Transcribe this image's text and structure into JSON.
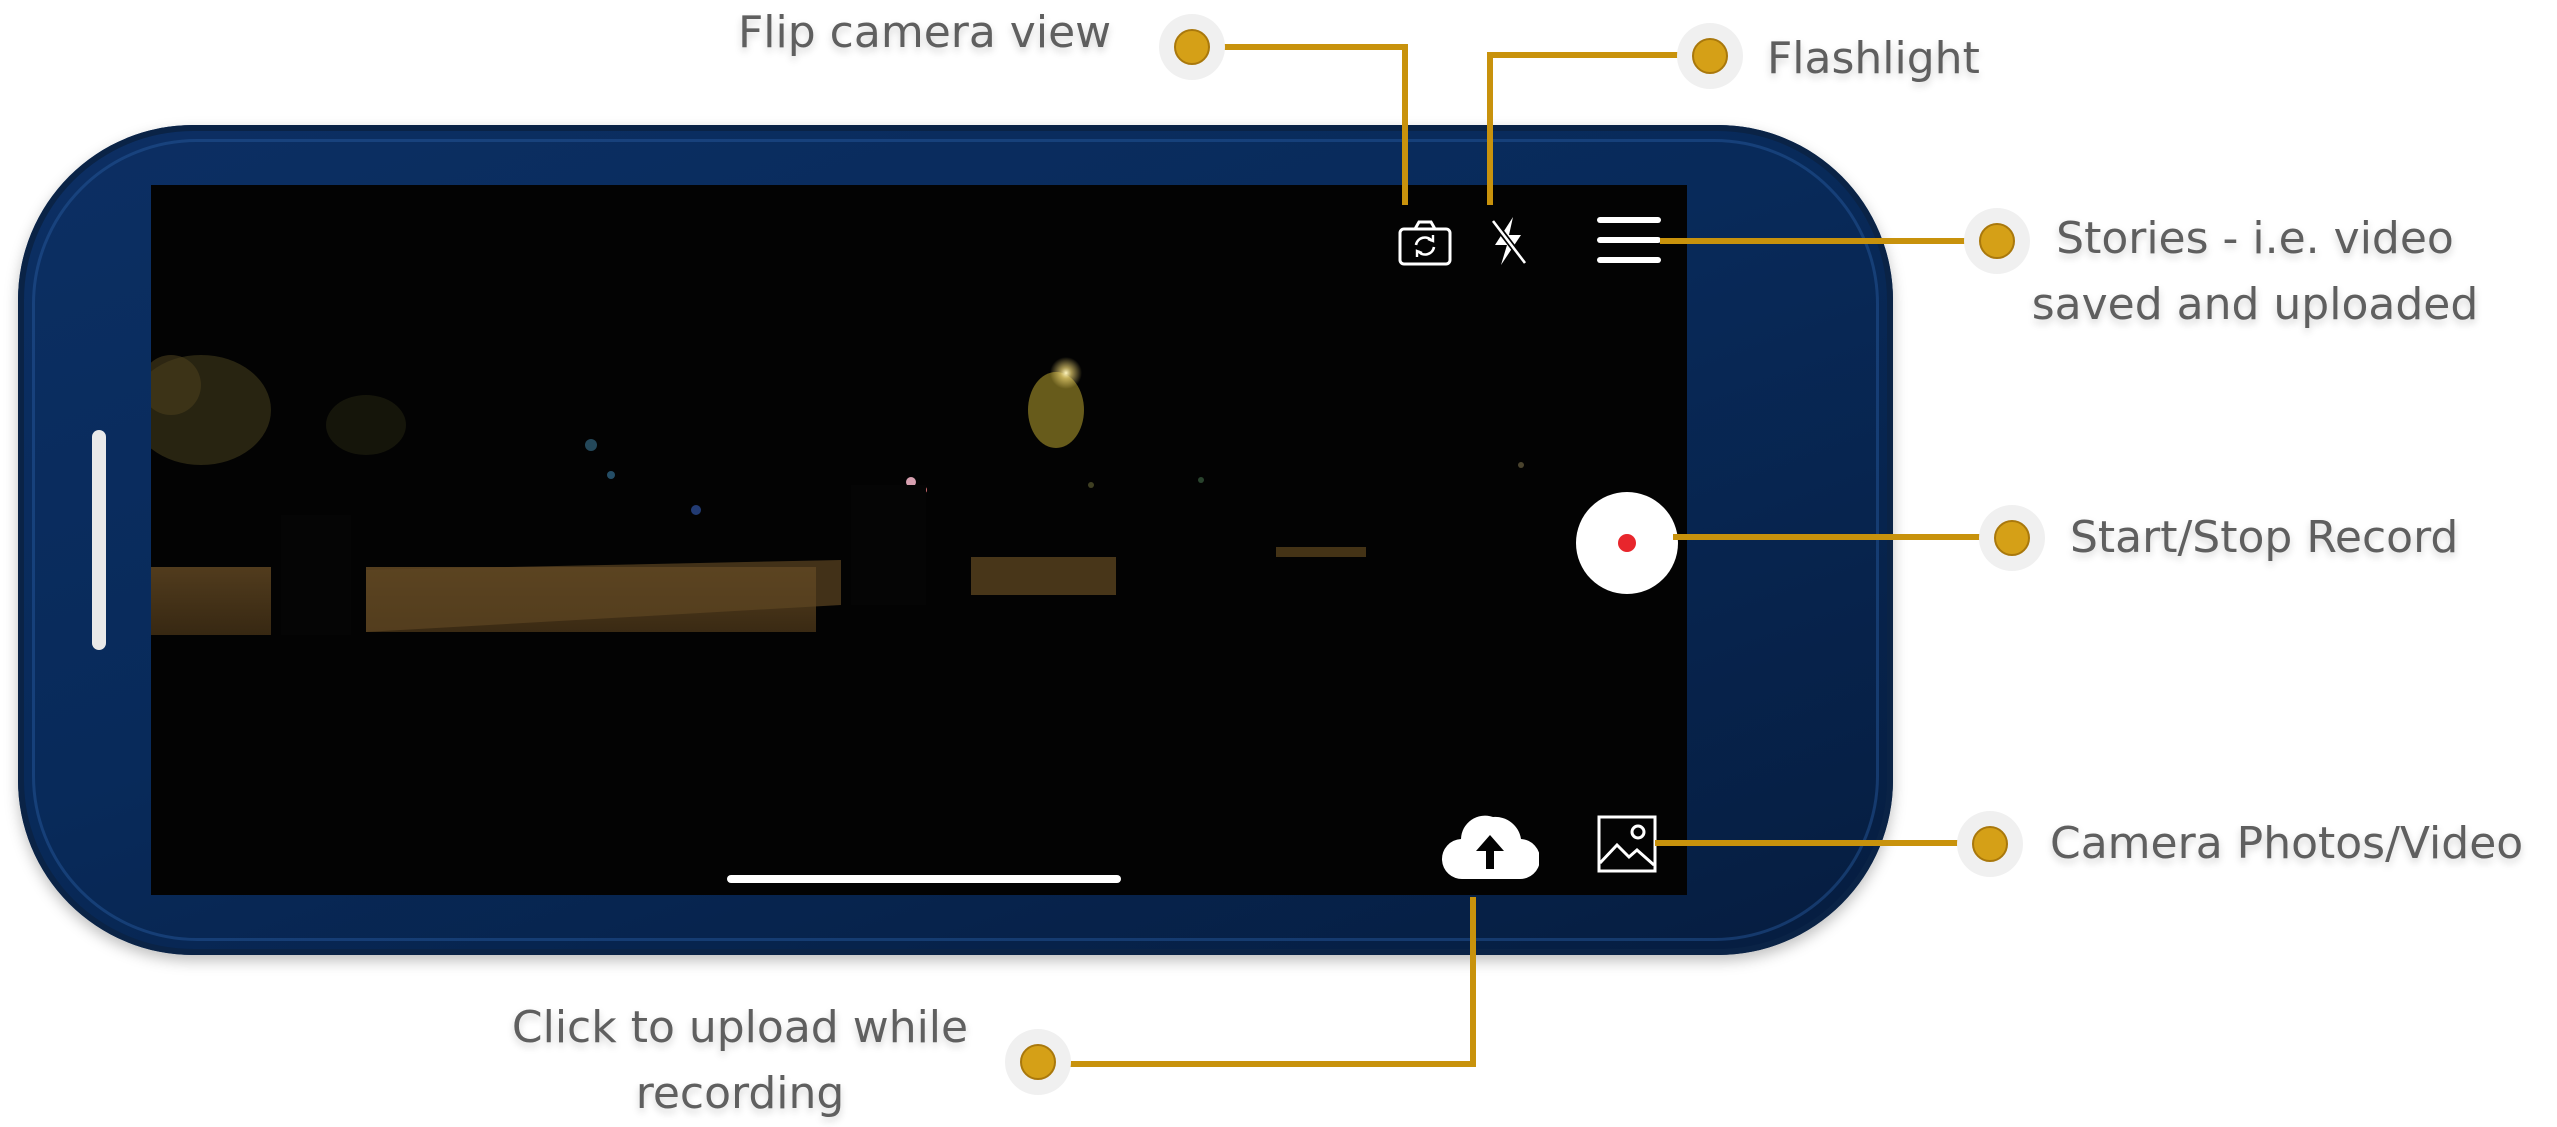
{
  "labels": {
    "flip_camera": "Flip camera view",
    "flashlight": "Flashlight",
    "stories_line1": "Stories - i.e. video",
    "stories_line2": "saved and uploaded",
    "record": "Start/Stop Record",
    "camera_roll": "Camera Photos/Video",
    "upload_line1": "Click to upload while",
    "upload_line2": "recording"
  },
  "icons": {
    "flip_camera": "camera-flip-icon",
    "flashlight": "flash-off-icon",
    "stories": "menu-icon",
    "record": "record-button",
    "camera_roll": "gallery-icon",
    "upload": "cloud-upload-icon"
  },
  "colors": {
    "leader": "#c8920c",
    "dot": "#d5a017",
    "phone_body": "#0a2b5c",
    "record_dot": "#e8262c",
    "label_text": "#5f5f5f"
  }
}
